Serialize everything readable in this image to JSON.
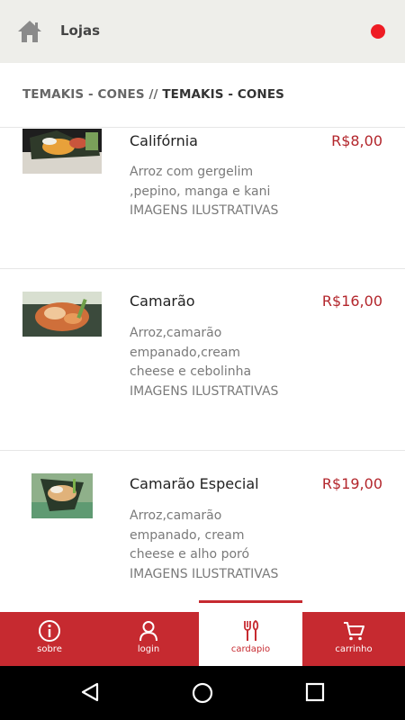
{
  "topbar": {
    "title": "Lojas",
    "status_color": "#ee1c24"
  },
  "breadcrumb": {
    "category": "TEMAKIS - CONES",
    "separator": " // ",
    "current": "TEMAKIS - CONES"
  },
  "items": [
    {
      "name": "Califórnia",
      "price": "R$8,00",
      "description": "Arroz com gergelim ,pepino, manga e kani IMAGENS ILUSTRATIVAS"
    },
    {
      "name": "Camarão",
      "price": "R$16,00",
      "description": "Arroz,camarão empanado,cream cheese e cebolinha IMAGENS ILUSTRATIVAS"
    },
    {
      "name": "Camarão Especial",
      "price": "R$19,00",
      "description": "Arroz,camarão empanado, cream cheese e alho poró IMAGENS ILUSTRATIVAS"
    }
  ],
  "bottom_nav": {
    "items": [
      {
        "label": "sobre",
        "icon": "info-icon"
      },
      {
        "label": "login",
        "icon": "user-icon"
      },
      {
        "label": "cardapio",
        "icon": "cutlery-icon"
      },
      {
        "label": "carrinho",
        "icon": "cart-icon"
      }
    ],
    "active": "cardapio"
  },
  "colors": {
    "accent": "#c62a30",
    "price": "#b3262c",
    "topbar_bg": "#eeeeea"
  }
}
